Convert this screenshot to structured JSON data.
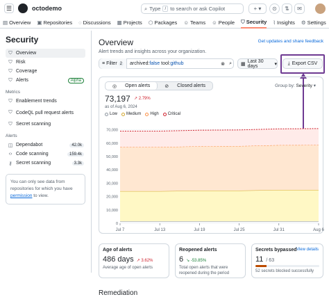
{
  "org": "octodemo",
  "search": {
    "type_label": "Type",
    "slash": "/",
    "rest": "to search or ask Copilot"
  },
  "nav": [
    {
      "label": "Overview",
      "icon": "book-icon"
    },
    {
      "label": "Repositories",
      "icon": "repo-icon"
    },
    {
      "label": "Discussions",
      "icon": "comment-icon"
    },
    {
      "label": "Projects",
      "icon": "table-icon"
    },
    {
      "label": "Packages",
      "icon": "package-icon"
    },
    {
      "label": "Teams",
      "icon": "people-icon"
    },
    {
      "label": "People",
      "icon": "person-icon"
    },
    {
      "label": "Security",
      "icon": "shield-icon",
      "active": true
    },
    {
      "label": "Insights",
      "icon": "graph-icon"
    },
    {
      "label": "Settings",
      "icon": "gear-icon"
    }
  ],
  "sidebar": {
    "title": "Security",
    "items": [
      {
        "label": "Overview",
        "icon": "graph-icon",
        "selected": true
      },
      {
        "label": "Risk",
        "icon": "shield-icon"
      },
      {
        "label": "Coverage",
        "icon": "shield-check-icon"
      },
      {
        "label": "Alerts",
        "icon": "shield-icon",
        "badge": "Alpha"
      }
    ],
    "metrics_heading": "Metrics",
    "metrics": [
      {
        "label": "Enablement trends",
        "icon": "graph-icon"
      },
      {
        "label": "CodeQL pull request alerts",
        "icon": "graph-icon"
      },
      {
        "label": "Secret scanning",
        "icon": "graph-icon"
      }
    ],
    "alerts_heading": "Alerts",
    "alerts": [
      {
        "label": "Dependabot",
        "icon": "dependabot-icon",
        "count": "42.0k"
      },
      {
        "label": "Code scanning",
        "icon": "code-icon",
        "count": "159.4k"
      },
      {
        "label": "Secret scanning",
        "icon": "key-icon",
        "count": "3.3k"
      }
    ],
    "note_pre": "You can only see data from repositories for which you have",
    "note_link": "permission",
    "note_post": "to view."
  },
  "main": {
    "title": "Overview",
    "subtitle": "Alert trends and insights across your organization.",
    "feedback": "Get updates and share feedback",
    "filter_label": "Filter",
    "filter_count": "2",
    "query_k1": "archived:",
    "query_v1": "false",
    "query_k2": " tool:",
    "query_v2": "github",
    "days": "Last 30 days",
    "export": "Export CSV",
    "tab_open": "Open alerts",
    "tab_closed": "Closed alerts",
    "group_label": "Group by:",
    "group_value": "Severity",
    "total": "73,197",
    "total_delta": "2.79%",
    "total_delta_sub": "as of Aug 6, 2024",
    "legend": [
      {
        "label": "Low",
        "color": "#8c959f"
      },
      {
        "label": "Medium",
        "color": "#d4a72c"
      },
      {
        "label": "High",
        "color": "#fb8f44"
      },
      {
        "label": "Critical",
        "color": "#cf222e"
      }
    ],
    "remediation": "Remediation"
  },
  "chart_data": {
    "type": "area",
    "stacked": true,
    "x": [
      "Jul 7",
      "Jul 13",
      "Jul 19",
      "Jul 25",
      "Jul 31",
      "Aug 6"
    ],
    "yticks": [
      "0",
      "10,000",
      "20,000",
      "30,000",
      "40,000",
      "50,000",
      "60,000",
      "70,000"
    ],
    "ylim": [
      0,
      75000
    ],
    "series": [
      {
        "name": "Low",
        "color": "#8c959f",
        "values": [
          1500,
          1500,
          1500,
          1500,
          1500,
          1500
        ]
      },
      {
        "name": "Medium",
        "color": "#d4a72c",
        "values": [
          22500,
          22500,
          23000,
          23000,
          23500,
          23500
        ]
      },
      {
        "name": "High",
        "color": "#fb8f44",
        "values": [
          33000,
          33000,
          33200,
          33300,
          33500,
          33600
        ]
      },
      {
        "name": "Critical",
        "color": "#cf222e",
        "values": [
          12000,
          12000,
          12000,
          12100,
          12200,
          12300
        ]
      }
    ]
  },
  "metrics_cards": [
    {
      "title": "Age of alerts",
      "value": "486 days",
      "delta": "3.62%",
      "sub": "Average age of open alerts"
    },
    {
      "title": "Reopened alerts",
      "value": "6",
      "delta": "-53.85%",
      "sub": "Total open alerts that were reopened during the period"
    },
    {
      "title": "Secrets bypassed",
      "value": "11",
      "value_sub": "/ 63",
      "link": "View details",
      "sub": "52 secrets blocked successfully",
      "progress": 0.17
    }
  ]
}
